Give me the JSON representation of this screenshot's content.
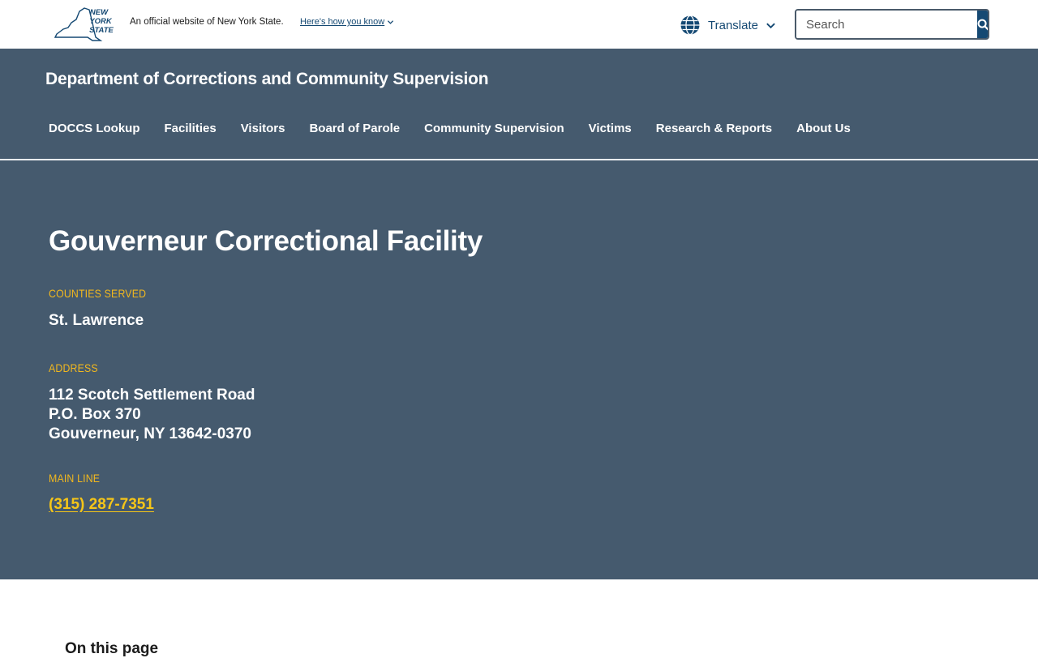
{
  "universal_header": {
    "logo_text": "NEW YORK STATE",
    "official_text": "An official website of New York State.",
    "how_link": "Here's how you know",
    "translate_label": "Translate",
    "search_placeholder": "Search"
  },
  "agency": {
    "title": "Department of Corrections and Community Supervision",
    "nav": [
      "DOCCS Lookup",
      "Facilities",
      "Visitors",
      "Board of Parole",
      "Community Supervision",
      "Victims",
      "Research & Reports",
      "About Us"
    ]
  },
  "facility": {
    "name": "Gouverneur Correctional Facility",
    "counties_label": "COUNTIES SERVED",
    "counties_value": "St. Lawrence",
    "address_label": "ADDRESS",
    "address_lines": [
      "112 Scotch Settlement Road",
      "P.O. Box 370",
      "Gouverneur, NY 13642-0370"
    ],
    "main_line_label": "MAIN LINE",
    "main_line_value": "(315) 287-7351"
  },
  "below": {
    "on_this_page": "On this page"
  },
  "colors": {
    "hero_bg": "#455a6e",
    "accent_gold": "#f2b81e",
    "ny_blue": "#154973"
  }
}
